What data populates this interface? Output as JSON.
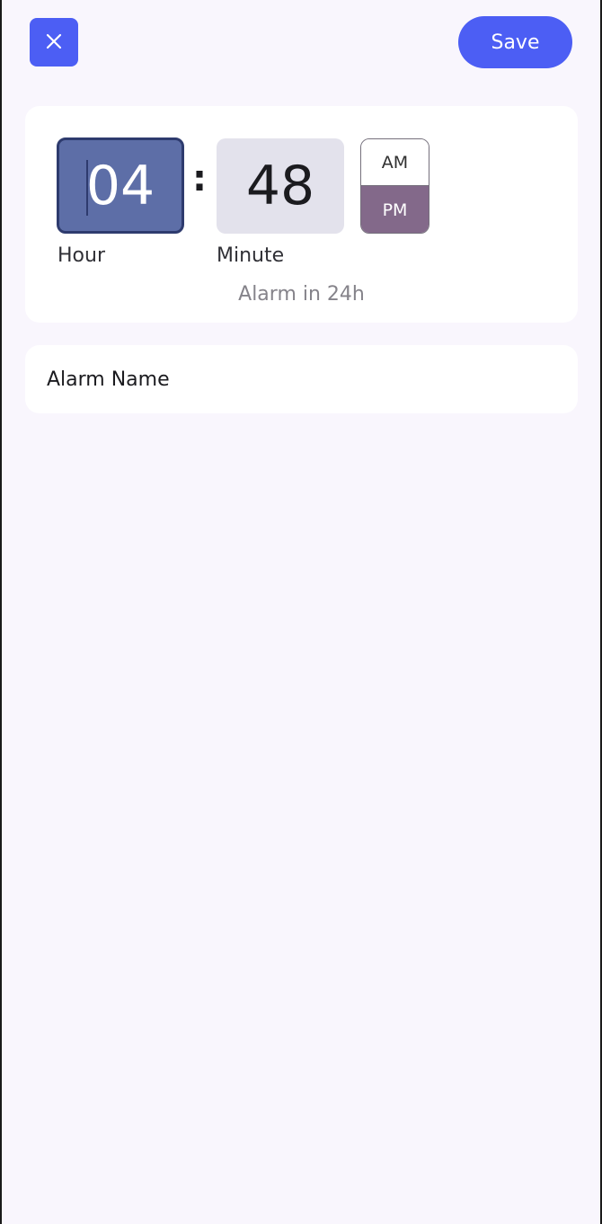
{
  "toolbar": {
    "save_label": "Save"
  },
  "time": {
    "hour": "04",
    "minute": "48",
    "separator": ":",
    "hour_label": "Hour",
    "minute_label": "Minute",
    "am_label": "AM",
    "pm_label": "PM",
    "selected_period": "PM",
    "alarm_in": "Alarm in 24h"
  },
  "name": {
    "label": "Alarm Name"
  },
  "colors": {
    "accent": "#4c5ef4",
    "hour_active_bg": "#5d6ea7",
    "pm_selected_bg": "#83698a",
    "page_bg": "#f9f6fd"
  },
  "icons": {
    "close": "close-icon"
  }
}
